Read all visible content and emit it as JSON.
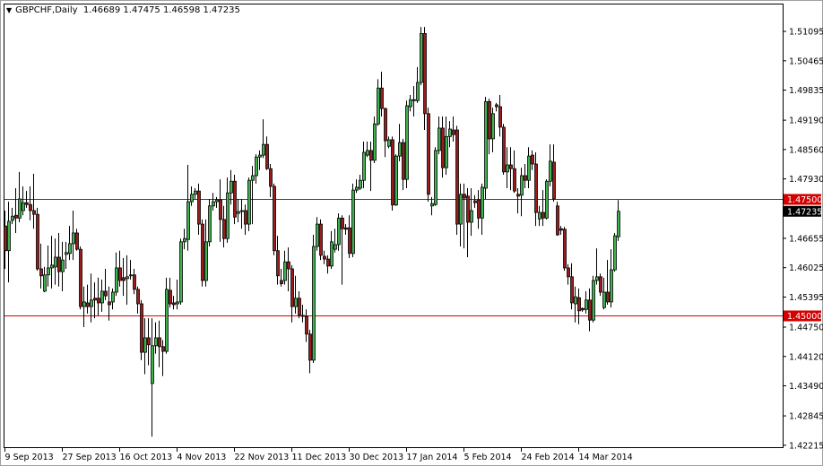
{
  "header": {
    "symbol": "GBPCHF,Daily",
    "ohlc_text": "1.46689 1.47475 1.46598 1.47235",
    "menu_icon": "triangle-down-icon"
  },
  "colors": {
    "bull": "#3fb34f",
    "bear": "#9b1c1c",
    "wick": "#000000",
    "hline": "#d40000",
    "current_bg": "#000000"
  },
  "chart_data": {
    "type": "candlestick",
    "title": "GBPCHF,Daily",
    "ylim": [
      1.4205,
      1.5165
    ],
    "y_ticks": [
      "1.51095",
      "1.50465",
      "1.49835",
      "1.49190",
      "1.48560",
      "1.47930",
      "1.46655",
      "1.46025",
      "1.45395",
      "1.44750",
      "1.44120",
      "1.43490",
      "1.42845",
      "1.42215"
    ],
    "x_labels": [
      {
        "bar": 0,
        "label": "9 Sep 2013"
      },
      {
        "bar": 16,
        "label": "27 Sep 2013"
      },
      {
        "bar": 32,
        "label": "16 Oct 2013"
      },
      {
        "bar": 48,
        "label": "4 Nov 2013"
      },
      {
        "bar": 64,
        "label": "22 Nov 2013"
      },
      {
        "bar": 80,
        "label": "11 Dec 2013"
      },
      {
        "bar": 96,
        "label": "30 Dec 2013"
      },
      {
        "bar": 112,
        "label": "17 Jan 2014"
      },
      {
        "bar": 128,
        "label": "5 Feb 2014"
      },
      {
        "bar": 144,
        "label": "24 Feb 2014"
      },
      {
        "bar": 160,
        "label": "14 Mar 2014"
      }
    ],
    "horizontal_lines": [
      {
        "price": 1.475,
        "label": "1.47500"
      },
      {
        "price": 1.45,
        "label": "1.45000"
      }
    ],
    "current_price": {
      "price": 1.47235,
      "label": "1.47235"
    },
    "ohlc_format": "[open, high, low, close]",
    "candles": [
      [
        1.4692,
        1.4725,
        1.46,
        1.4639
      ],
      [
        1.4639,
        1.4744,
        1.4571,
        1.4702
      ],
      [
        1.4704,
        1.4731,
        1.4696,
        1.4713
      ],
      [
        1.4715,
        1.4773,
        1.4677,
        1.4709
      ],
      [
        1.4709,
        1.4808,
        1.47,
        1.475
      ],
      [
        1.4725,
        1.4777,
        1.4715,
        1.4742
      ],
      [
        1.4742,
        1.4767,
        1.4731,
        1.4738
      ],
      [
        1.4738,
        1.4777,
        1.4704,
        1.4725
      ],
      [
        1.4725,
        1.4804,
        1.4686,
        1.4717
      ],
      [
        1.4717,
        1.4731,
        1.4596,
        1.46
      ],
      [
        1.46,
        1.4654,
        1.4558,
        1.4585
      ],
      [
        1.4552,
        1.4604,
        1.455,
        1.4587
      ],
      [
        1.4587,
        1.465,
        1.4562,
        1.4602
      ],
      [
        1.4602,
        1.4671,
        1.4558,
        1.4608
      ],
      [
        1.4604,
        1.4665,
        1.4566,
        1.4625
      ],
      [
        1.4625,
        1.4677,
        1.4562,
        1.4594
      ],
      [
        1.4594,
        1.4658,
        1.4552,
        1.4619
      ],
      [
        1.4631,
        1.4658,
        1.46,
        1.4635
      ],
      [
        1.4633,
        1.4692,
        1.4619,
        1.4654
      ],
      [
        1.4654,
        1.4725,
        1.4619,
        1.4677
      ],
      [
        1.4677,
        1.4686,
        1.4639,
        1.4642
      ],
      [
        1.4642,
        1.4648,
        1.4513,
        1.4519
      ],
      [
        1.4519,
        1.4562,
        1.4475,
        1.4529
      ],
      [
        1.4527,
        1.4566,
        1.4504,
        1.4519
      ],
      [
        1.4519,
        1.459,
        1.4485,
        1.4533
      ],
      [
        1.4537,
        1.4571,
        1.4494,
        1.4533
      ],
      [
        1.4537,
        1.4581,
        1.45,
        1.4527
      ],
      [
        1.4527,
        1.4577,
        1.4508,
        1.4552
      ],
      [
        1.4552,
        1.46,
        1.4533,
        1.4542
      ],
      [
        1.4529,
        1.4562,
        1.4489,
        1.4523
      ],
      [
        1.4529,
        1.4558,
        1.4513,
        1.455
      ],
      [
        1.455,
        1.4635,
        1.4542,
        1.4602
      ],
      [
        1.4602,
        1.4639,
        1.4562,
        1.4575
      ],
      [
        1.4581,
        1.4623,
        1.4542,
        1.4575
      ],
      [
        1.4579,
        1.4629,
        1.4523,
        1.4583
      ],
      [
        1.4585,
        1.4619,
        1.4577,
        1.4587
      ],
      [
        1.4587,
        1.46,
        1.4546,
        1.4556
      ],
      [
        1.4556,
        1.4562,
        1.4504,
        1.4525
      ],
      [
        1.4525,
        1.4533,
        1.4404,
        1.4421
      ],
      [
        1.4421,
        1.4494,
        1.4374,
        1.4452
      ],
      [
        1.4452,
        1.4494,
        1.4393,
        1.4437
      ],
      [
        1.4354,
        1.4494,
        1.424,
        1.4435
      ],
      [
        1.4435,
        1.4485,
        1.4418,
        1.4452
      ],
      [
        1.4452,
        1.4489,
        1.4389,
        1.4433
      ],
      [
        1.4433,
        1.4447,
        1.437,
        1.4423
      ],
      [
        1.4423,
        1.4581,
        1.4418,
        1.4556
      ],
      [
        1.4554,
        1.4581,
        1.4517,
        1.4525
      ],
      [
        1.4527,
        1.4542,
        1.4513,
        1.4523
      ],
      [
        1.4525,
        1.4577,
        1.4513,
        1.4529
      ],
      [
        1.4529,
        1.4665,
        1.4523,
        1.4658
      ],
      [
        1.4658,
        1.4686,
        1.4642,
        1.4665
      ],
      [
        1.4663,
        1.4823,
        1.4639,
        1.4744
      ],
      [
        1.4744,
        1.4777,
        1.4735,
        1.476
      ],
      [
        1.476,
        1.4773,
        1.475,
        1.4767
      ],
      [
        1.4767,
        1.4783,
        1.4673,
        1.4696
      ],
      [
        1.4696,
        1.4706,
        1.4562,
        1.4575
      ],
      [
        1.4575,
        1.4706,
        1.4562,
        1.4658
      ],
      [
        1.4658,
        1.475,
        1.4648,
        1.4735
      ],
      [
        1.4735,
        1.4763,
        1.4725,
        1.4744
      ],
      [
        1.4744,
        1.4754,
        1.4731,
        1.4748
      ],
      [
        1.4748,
        1.4792,
        1.4658,
        1.4706
      ],
      [
        1.4706,
        1.4735,
        1.4646,
        1.4665
      ],
      [
        1.4665,
        1.4796,
        1.4656,
        1.4763
      ],
      [
        1.4763,
        1.4812,
        1.4738,
        1.4788
      ],
      [
        1.4788,
        1.4802,
        1.4696,
        1.4711
      ],
      [
        1.4719,
        1.475,
        1.47,
        1.4723
      ],
      [
        1.4723,
        1.475,
        1.4686,
        1.4725
      ],
      [
        1.4725,
        1.4738,
        1.4673,
        1.4696
      ],
      [
        1.4696,
        1.4796,
        1.4681,
        1.479
      ],
      [
        1.479,
        1.4821,
        1.4696,
        1.48
      ],
      [
        1.48,
        1.4846,
        1.4783,
        1.484
      ],
      [
        1.484,
        1.4854,
        1.4812,
        1.4844
      ],
      [
        1.4844,
        1.4921,
        1.4838,
        1.4867
      ],
      [
        1.4867,
        1.4884,
        1.4812,
        1.4815
      ],
      [
        1.4815,
        1.4825,
        1.4754,
        1.4777
      ],
      [
        1.4777,
        1.4783,
        1.4629,
        1.4639
      ],
      [
        1.4639,
        1.4671,
        1.4566,
        1.4585
      ],
      [
        1.4575,
        1.46,
        1.4562,
        1.4568
      ],
      [
        1.4575,
        1.4639,
        1.4566,
        1.4615
      ],
      [
        1.4615,
        1.4646,
        1.4552,
        1.46
      ],
      [
        1.46,
        1.4608,
        1.4485,
        1.4519
      ],
      [
        1.4519,
        1.4585,
        1.4504,
        1.4537
      ],
      [
        1.4537,
        1.4552,
        1.4494,
        1.45
      ],
      [
        1.45,
        1.4523,
        1.4485,
        1.4498
      ],
      [
        1.4498,
        1.4513,
        1.4443,
        1.446
      ],
      [
        1.446,
        1.4469,
        1.4376,
        1.4404
      ],
      [
        1.4404,
        1.4673,
        1.4398,
        1.4648
      ],
      [
        1.4648,
        1.4711,
        1.4639,
        1.4696
      ],
      [
        1.4696,
        1.4706,
        1.4619,
        1.4629
      ],
      [
        1.4627,
        1.4639,
        1.461,
        1.4621
      ],
      [
        1.4621,
        1.4629,
        1.459,
        1.4606
      ],
      [
        1.4606,
        1.4681,
        1.46,
        1.4658
      ],
      [
        1.4642,
        1.4686,
        1.4635,
        1.4652
      ],
      [
        1.4652,
        1.4719,
        1.4639,
        1.4709
      ],
      [
        1.4709,
        1.4715,
        1.4566,
        1.4686
      ],
      [
        1.4688,
        1.4696,
        1.4673,
        1.4685
      ],
      [
        1.4688,
        1.4715,
        1.4623,
        1.4633
      ],
      [
        1.4633,
        1.4783,
        1.4625,
        1.4769
      ],
      [
        1.4769,
        1.4792,
        1.4763,
        1.4775
      ],
      [
        1.4773,
        1.4802,
        1.4769,
        1.479
      ],
      [
        1.479,
        1.4873,
        1.4773,
        1.485
      ],
      [
        1.4844,
        1.4873,
        1.484,
        1.4854
      ],
      [
        1.4854,
        1.4873,
        1.4767,
        1.4833
      ],
      [
        1.4833,
        1.4927,
        1.4827,
        1.4911
      ],
      [
        1.4911,
        1.5007,
        1.4907,
        1.4988
      ],
      [
        1.4988,
        1.5023,
        1.4927,
        1.4944
      ],
      [
        1.4944,
        1.4946,
        1.484,
        1.4875
      ],
      [
        1.4863,
        1.4884,
        1.4859,
        1.4877
      ],
      [
        1.4877,
        1.4884,
        1.4725,
        1.4737
      ],
      [
        1.4737,
        1.4846,
        1.4735,
        1.4842
      ],
      [
        1.4842,
        1.4911,
        1.4831,
        1.4871
      ],
      [
        1.4871,
        1.4879,
        1.4769,
        1.4792
      ],
      [
        1.4792,
        1.4961,
        1.4773,
        1.495
      ],
      [
        1.4948,
        1.4973,
        1.4938,
        1.4963
      ],
      [
        1.4963,
        1.4992,
        1.4927,
        1.4961
      ],
      [
        1.4961,
        1.5033,
        1.4956,
        1.5
      ],
      [
        1.5,
        1.5119,
        1.4994,
        1.5105
      ],
      [
        1.5105,
        1.5119,
        1.4898,
        1.4933
      ],
      [
        1.4933,
        1.4946,
        1.4744,
        1.476
      ],
      [
        1.4735,
        1.4754,
        1.4715,
        1.474
      ],
      [
        1.4738,
        1.4861,
        1.4735,
        1.4854
      ],
      [
        1.4854,
        1.4927,
        1.4846,
        1.4902
      ],
      [
        1.4902,
        1.4927,
        1.4796,
        1.4817
      ],
      [
        1.4817,
        1.4927,
        1.4802,
        1.4884
      ],
      [
        1.4884,
        1.4917,
        1.4861,
        1.49
      ],
      [
        1.4898,
        1.4927,
        1.4873,
        1.4888
      ],
      [
        1.4898,
        1.4907,
        1.4673,
        1.4696
      ],
      [
        1.4696,
        1.4783,
        1.4648,
        1.476
      ],
      [
        1.476,
        1.4783,
        1.4644,
        1.4752
      ],
      [
        1.4756,
        1.4773,
        1.4625,
        1.47
      ],
      [
        1.47,
        1.4773,
        1.4671,
        1.4725
      ],
      [
        1.4746,
        1.4758,
        1.4731,
        1.4742
      ],
      [
        1.4748,
        1.4769,
        1.4686,
        1.4709
      ],
      [
        1.4709,
        1.4783,
        1.4673,
        1.4775
      ],
      [
        1.4773,
        1.4969,
        1.475,
        1.4959
      ],
      [
        1.4959,
        1.4965,
        1.4846,
        1.4879
      ],
      [
        1.4879,
        1.4946,
        1.485,
        1.4933
      ],
      [
        1.4952,
        1.4956,
        1.4938,
        1.4948
      ],
      [
        1.4948,
        1.4973,
        1.4884,
        1.4904
      ],
      [
        1.4904,
        1.4911,
        1.4802,
        1.4808
      ],
      [
        1.4808,
        1.4861,
        1.4773,
        1.4823
      ],
      [
        1.4823,
        1.4861,
        1.4769,
        1.4815
      ],
      [
        1.4815,
        1.4854,
        1.4763,
        1.4767
      ],
      [
        1.476,
        1.4773,
        1.4719,
        1.4756
      ],
      [
        1.4758,
        1.4817,
        1.4713,
        1.48
      ],
      [
        1.48,
        1.4825,
        1.4773,
        1.479
      ],
      [
        1.479,
        1.4861,
        1.4773,
        1.4842
      ],
      [
        1.4844,
        1.4854,
        1.4812,
        1.4825
      ],
      [
        1.4825,
        1.485,
        1.4692,
        1.4721
      ],
      [
        1.4707,
        1.4735,
        1.4692,
        1.4721
      ],
      [
        1.4721,
        1.4769,
        1.4692,
        1.4709
      ],
      [
        1.4709,
        1.4792,
        1.4706,
        1.4788
      ],
      [
        1.4788,
        1.4867,
        1.4777,
        1.4831
      ],
      [
        1.4829,
        1.4867,
        1.4744,
        1.475
      ],
      [
        1.4735,
        1.4744,
        1.4671,
        1.4673
      ],
      [
        1.4686,
        1.4692,
        1.4673,
        1.4683
      ],
      [
        1.4685,
        1.469,
        1.4596,
        1.4602
      ],
      [
        1.4602,
        1.461,
        1.4566,
        1.4583
      ],
      [
        1.4583,
        1.4612,
        1.4513,
        1.4527
      ],
      [
        1.4525,
        1.4562,
        1.4485,
        1.454
      ],
      [
        1.4538,
        1.4558,
        1.4481,
        1.451
      ],
      [
        1.4515,
        1.4517,
        1.4508,
        1.4512
      ],
      [
        1.4513,
        1.4552,
        1.4504,
        1.4533
      ],
      [
        1.4533,
        1.4558,
        1.4466,
        1.449
      ],
      [
        1.449,
        1.4585,
        1.4485,
        1.4575
      ],
      [
        1.4575,
        1.4644,
        1.4566,
        1.4583
      ],
      [
        1.4583,
        1.459,
        1.4542,
        1.455
      ],
      [
        1.4517,
        1.4581,
        1.4513,
        1.455
      ],
      [
        1.455,
        1.4619,
        1.4523,
        1.4529
      ],
      [
        1.4529,
        1.4642,
        1.4517,
        1.4598
      ],
      [
        1.4598,
        1.4677,
        1.4594,
        1.4671
      ],
      [
        1.46689,
        1.47475,
        1.46598,
        1.47235
      ]
    ]
  }
}
